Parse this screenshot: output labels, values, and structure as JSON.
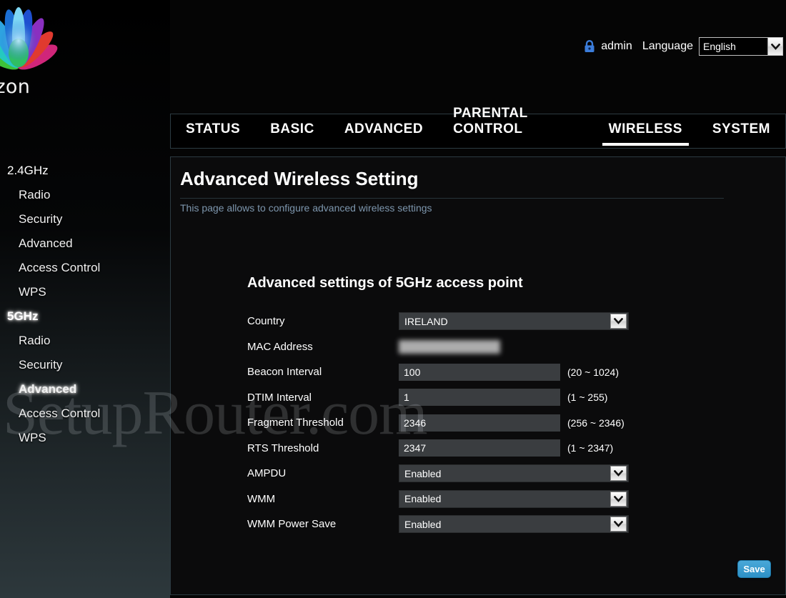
{
  "brand": {
    "name": "horizon",
    "logo_icon": "lotus-flower-logo",
    "petal_colors": [
      "#1b6fd4",
      "#2ea3e0",
      "#25c9c0",
      "#3ec23a",
      "#9cd12a",
      "#e03a2f",
      "#d0267a",
      "#8a2fc0",
      "#1e4fd0"
    ]
  },
  "topbar": {
    "lock_icon": "lock-icon",
    "user": "admin",
    "language_label": "Language",
    "language_value": "English",
    "language_options": [
      "English"
    ],
    "dropdown_icon": "chevron-down-icon"
  },
  "tabs": [
    {
      "label": "STATUS",
      "active": false
    },
    {
      "label": "BASIC",
      "active": false
    },
    {
      "label": "ADVANCED",
      "active": false
    },
    {
      "label": "PARENTAL CONTROL",
      "active": false
    },
    {
      "label": "WIRELESS",
      "active": true
    },
    {
      "label": "SYSTEM",
      "active": false
    }
  ],
  "sidebar": {
    "groups": [
      {
        "label": "2.4GHz",
        "active": false,
        "items": [
          {
            "label": "Radio",
            "active": false
          },
          {
            "label": "Security",
            "active": false
          },
          {
            "label": "Advanced",
            "active": false
          },
          {
            "label": "Access Control",
            "active": false
          },
          {
            "label": "WPS",
            "active": false
          }
        ]
      },
      {
        "label": "5GHz",
        "active": true,
        "items": [
          {
            "label": "Radio",
            "active": false
          },
          {
            "label": "Security",
            "active": false
          },
          {
            "label": "Advanced",
            "active": true
          },
          {
            "label": "Access Control",
            "active": false
          },
          {
            "label": "WPS",
            "active": false
          }
        ]
      }
    ]
  },
  "page": {
    "title": "Advanced Wireless Setting",
    "subtitle": "This page allows to configure advanced wireless settings",
    "section_title": "Advanced settings of 5GHz access point"
  },
  "form": {
    "fields": [
      {
        "label": "Country",
        "type": "select",
        "value": "IRELAND",
        "hint": "",
        "name": "country"
      },
      {
        "label": "MAC Address",
        "type": "masked",
        "value": "",
        "hint": "",
        "name": "mac-address"
      },
      {
        "label": "Beacon Interval",
        "type": "text",
        "value": "100",
        "hint": "(20 ~ 1024)",
        "name": "beacon-interval"
      },
      {
        "label": "DTIM Interval",
        "type": "text",
        "value": "1",
        "hint": "(1 ~ 255)",
        "name": "dtim-interval"
      },
      {
        "label": "Fragment Threshold",
        "type": "text",
        "value": "2346",
        "hint": "(256 ~ 2346)",
        "name": "fragment-threshold"
      },
      {
        "label": "RTS Threshold",
        "type": "text",
        "value": "2347",
        "hint": "(1 ~ 2347)",
        "name": "rts-threshold"
      },
      {
        "label": "AMPDU",
        "type": "select",
        "value": "Enabled",
        "hint": "",
        "name": "ampdu"
      },
      {
        "label": "WMM",
        "type": "select",
        "value": "Enabled",
        "hint": "",
        "name": "wmm"
      },
      {
        "label": "WMM Power Save",
        "type": "select",
        "value": "Enabled",
        "hint": "",
        "name": "wmm-power-save"
      }
    ],
    "save_label": "Save"
  },
  "watermark": {
    "text": "SetupRouter.com"
  },
  "colors": {
    "accent": "#2d91c6",
    "subtitle": "#7d96ad",
    "panel_bg": "#0b0b0c",
    "panel_border": "#2c3b42",
    "input_bg": "#3a3d40",
    "lock": "#3b7ddb"
  }
}
